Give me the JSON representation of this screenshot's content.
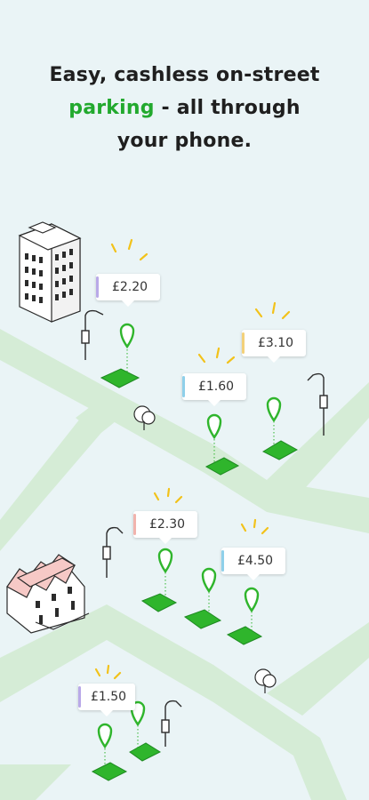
{
  "headline": {
    "line1": "Easy, cashless on-street",
    "line2_green": "parking",
    "line2_rest": " - all through",
    "line3": "your phone."
  },
  "colors": {
    "background": "#eaf4f6",
    "road": "#d5ecd6",
    "accent_green": "#22a92e",
    "bay": "#2fb52c",
    "spark": "#f2c21a"
  },
  "price_tags": [
    {
      "label": "£2.20",
      "accent": "#b9a9e8"
    },
    {
      "label": "£3.10",
      "accent": "#f3d17a"
    },
    {
      "label": "£1.60",
      "accent": "#8fd0ea"
    },
    {
      "label": "£2.30",
      "accent": "#f1b3ad"
    },
    {
      "label": "£4.50",
      "accent": "#8fd0ea"
    },
    {
      "label": "£1.50",
      "accent": "#b9a9e8"
    }
  ],
  "icons": {
    "pin": "location-pin-icon",
    "bay": "parking-bay-icon",
    "lamp": "street-lamp-icon",
    "tree": "tree-icon",
    "building": "office-building-icon",
    "houses": "terraced-houses-icon"
  }
}
